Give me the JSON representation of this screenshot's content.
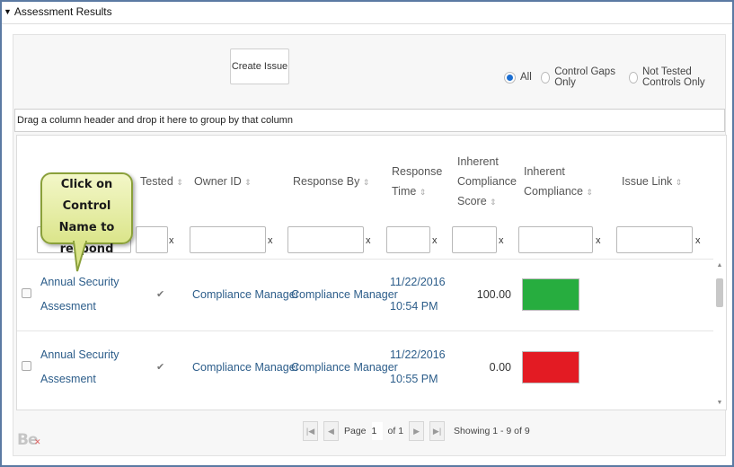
{
  "section": {
    "title": "Assessment Results"
  },
  "toolbar": {
    "create_issue_label": "Create Issue"
  },
  "filters": {
    "options": [
      "All",
      "Control Gaps Only",
      "Not Tested Controls Only"
    ],
    "selected": "All"
  },
  "group_bar": {
    "text": "Drag a column header and drop it here to group by that column"
  },
  "columns": {
    "tested": "Tested",
    "owner_id": "Owner ID",
    "response_by": "Response By",
    "response_time_1": "Response",
    "response_time_2": "Time",
    "ics_1": "Inherent",
    "ics_2": "Compliance",
    "ics_3": "Score",
    "ic_1": "Inherent",
    "ic_2": "Compliance",
    "issue_link": "Issue Link"
  },
  "filter_clear": "x",
  "rows": [
    {
      "name_1": "Annual Security",
      "name_2": "Assesment",
      "tested": "✔",
      "owner": "Compliance Manager",
      "response_by": "Compliance Manager",
      "date": "11/22/2016",
      "time": "10:54 PM",
      "score": "100.00",
      "color": "#27ad3f"
    },
    {
      "name_1": "Annual Security",
      "name_2": "Assesment",
      "tested": "✔",
      "owner": "Compliance Manager",
      "response_by": "Compliance Manager",
      "date": "11/22/2016",
      "time": "10:55 PM",
      "score": "0.00",
      "color": "#e31b23"
    }
  ],
  "pager": {
    "page_label": "Page",
    "page_value": "1",
    "of_label": "of 1",
    "showing": "Showing 1 - 9 of 9"
  },
  "callout": {
    "line1": "Click on Control",
    "line2": "Name to",
    "line3": "respond"
  },
  "logo": {
    "text": "Be"
  }
}
